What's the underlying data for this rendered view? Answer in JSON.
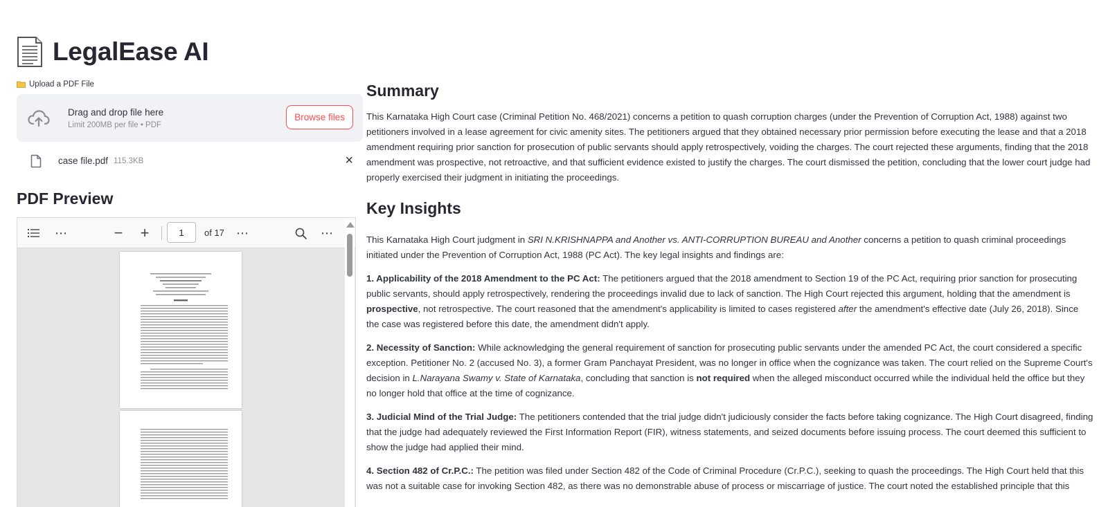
{
  "app": {
    "title": "LegalEase AI",
    "title_icon": "page-document-icon"
  },
  "upload": {
    "label": "Upload a PDF File",
    "label_icon": "folder-icon",
    "dropzone_main": "Drag and drop file here",
    "dropzone_sub": "Limit 200MB per file • PDF",
    "browse_label": "Browse files",
    "file_name": "case file.pdf",
    "file_size": "115.3KB",
    "remove_label": "×"
  },
  "pdf_preview": {
    "heading": "PDF Preview",
    "current_page": "1",
    "total_pages": "of 17",
    "toolbar": {
      "outline_icon": "☰",
      "more_left": "⋯",
      "zoom_out": "−",
      "zoom_in": "+",
      "more_mid": "⋯",
      "search_icon": "⌕",
      "more_right": "⋯"
    }
  },
  "summary": {
    "heading": "Summary",
    "text": "This Karnataka High Court case (Criminal Petition No. 468/2021) concerns a petition to quash corruption charges (under the Prevention of Corruption Act, 1988) against two petitioners involved in a lease agreement for civic amenity sites. The petitioners argued that they obtained necessary prior permission before executing the lease and that a 2018 amendment requiring prior sanction for prosecution of public servants should apply retrospectively, voiding the charges. The court rejected these arguments, finding that the 2018 amendment was prospective, not retroactive, and that sufficient evidence existed to justify the charges. The court dismissed the petition, concluding that the lower court judge had properly exercised their judgment in initiating the proceedings."
  },
  "insights": {
    "heading": "Key Insights",
    "intro_a": "This Karnataka High Court judgment in ",
    "intro_case": "SRI N.KRISHNAPPA and Another vs. ANTI-CORRUPTION BUREAU and Another",
    "intro_b": " concerns a petition to quash criminal proceedings initiated under the Prevention of Corruption Act, 1988 (PC Act). The key legal insights and findings are:",
    "i1_title": "1. Applicability of the 2018 Amendment to the PC Act:",
    "i1_a": " The petitioners argued that the 2018 amendment to Section 19 of the PC Act, requiring prior sanction for prosecuting public servants, should apply retrospectively, rendering the proceedings invalid due to lack of sanction. The High Court rejected this argument, holding that the amendment is ",
    "i1_bold": "prospective",
    "i1_b": ", not retrospective. The court reasoned that the amendment's applicability is limited to cases registered ",
    "i1_italic": "after",
    "i1_c": " the amendment's effective date (July 26, 2018). Since the case was registered before this date, the amendment didn't apply.",
    "i2_title": "2. Necessity of Sanction:",
    "i2_a": " While acknowledging the general requirement of sanction for prosecuting public servants under the amended PC Act, the court considered a specific exception. Petitioner No. 2 (accused No. 3), a former Gram Panchayat President, was no longer in office when the cognizance was taken. The court relied on the Supreme Court's decision in ",
    "i2_italic": "L.Narayana Swamy v. State of Karnataka",
    "i2_b": ", concluding that sanction is ",
    "i2_bold": "not required",
    "i2_c": " when the alleged misconduct occurred while the individual held the office but they no longer hold that office at the time of cognizance.",
    "i3_title": "3. Judicial Mind of the Trial Judge:",
    "i3_a": " The petitioners contended that the trial judge didn't judiciously consider the facts before taking cognizance. The High Court disagreed, finding that the judge had adequately reviewed the First Information Report (FIR), witness statements, and seized documents before issuing process. The court deemed this sufficient to show the judge had applied their mind.",
    "i4_title": "4. Section 482 of Cr.P.C.:",
    "i4_a": " The petition was filed under Section 482 of the Code of Criminal Procedure (Cr.P.C.), seeking to quash the proceedings. The High Court held that this was not a suitable case for invoking Section 482, as there was no demonstrable abuse of process or miscarriage of justice. The court noted the established principle that this"
  }
}
